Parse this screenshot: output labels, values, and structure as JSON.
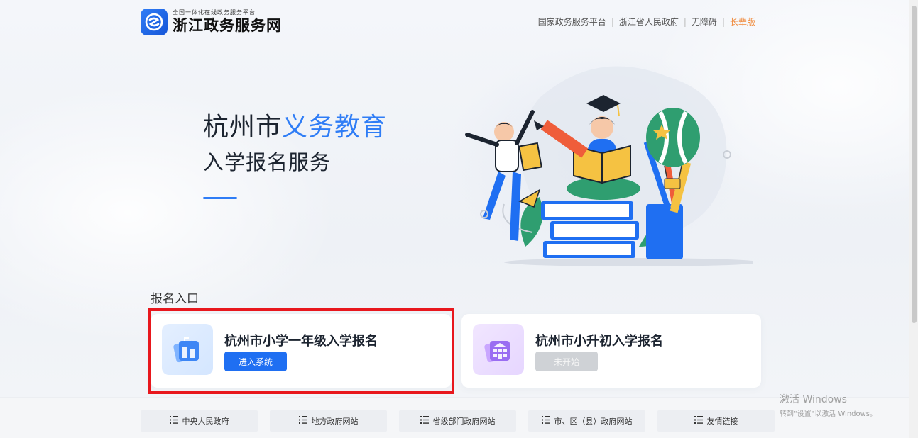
{
  "header": {
    "logo_sub": "全国一体化在线政务服务平台",
    "logo_main": "浙江政务服务网",
    "links": [
      {
        "label": "国家政务服务平台"
      },
      {
        "label": "浙江省人民政府"
      },
      {
        "label": "无障碍"
      },
      {
        "label": "长辈版"
      }
    ]
  },
  "hero": {
    "title_prefix": "杭州市",
    "title_accent": "义务教育",
    "subtitle": "入学报名服务"
  },
  "entry": {
    "section_title": "报名入口",
    "cards": [
      {
        "name": "杭州市小学一年级入学报名",
        "button": "进入系统",
        "icon": "school-building-icon"
      },
      {
        "name": "杭州市小升初入学报名",
        "button": "未开始",
        "icon": "school-building-icon"
      }
    ]
  },
  "footer": {
    "links": [
      {
        "label": "中央人民政府"
      },
      {
        "label": "地方政府网站"
      },
      {
        "label": "省级部门政府网站"
      },
      {
        "label": "市、区（县）政府网站"
      },
      {
        "label": "友情链接"
      }
    ]
  },
  "watermark": {
    "line1": "激活 Windows",
    "line2": "转到\"设置\"以激活 Windows。"
  },
  "colors": {
    "accent": "#2f7df6",
    "button_primary": "#1f6ff2",
    "button_disabled": "#cfd2d6",
    "elder_link": "#f08a3c",
    "highlight": "#e8171d"
  }
}
